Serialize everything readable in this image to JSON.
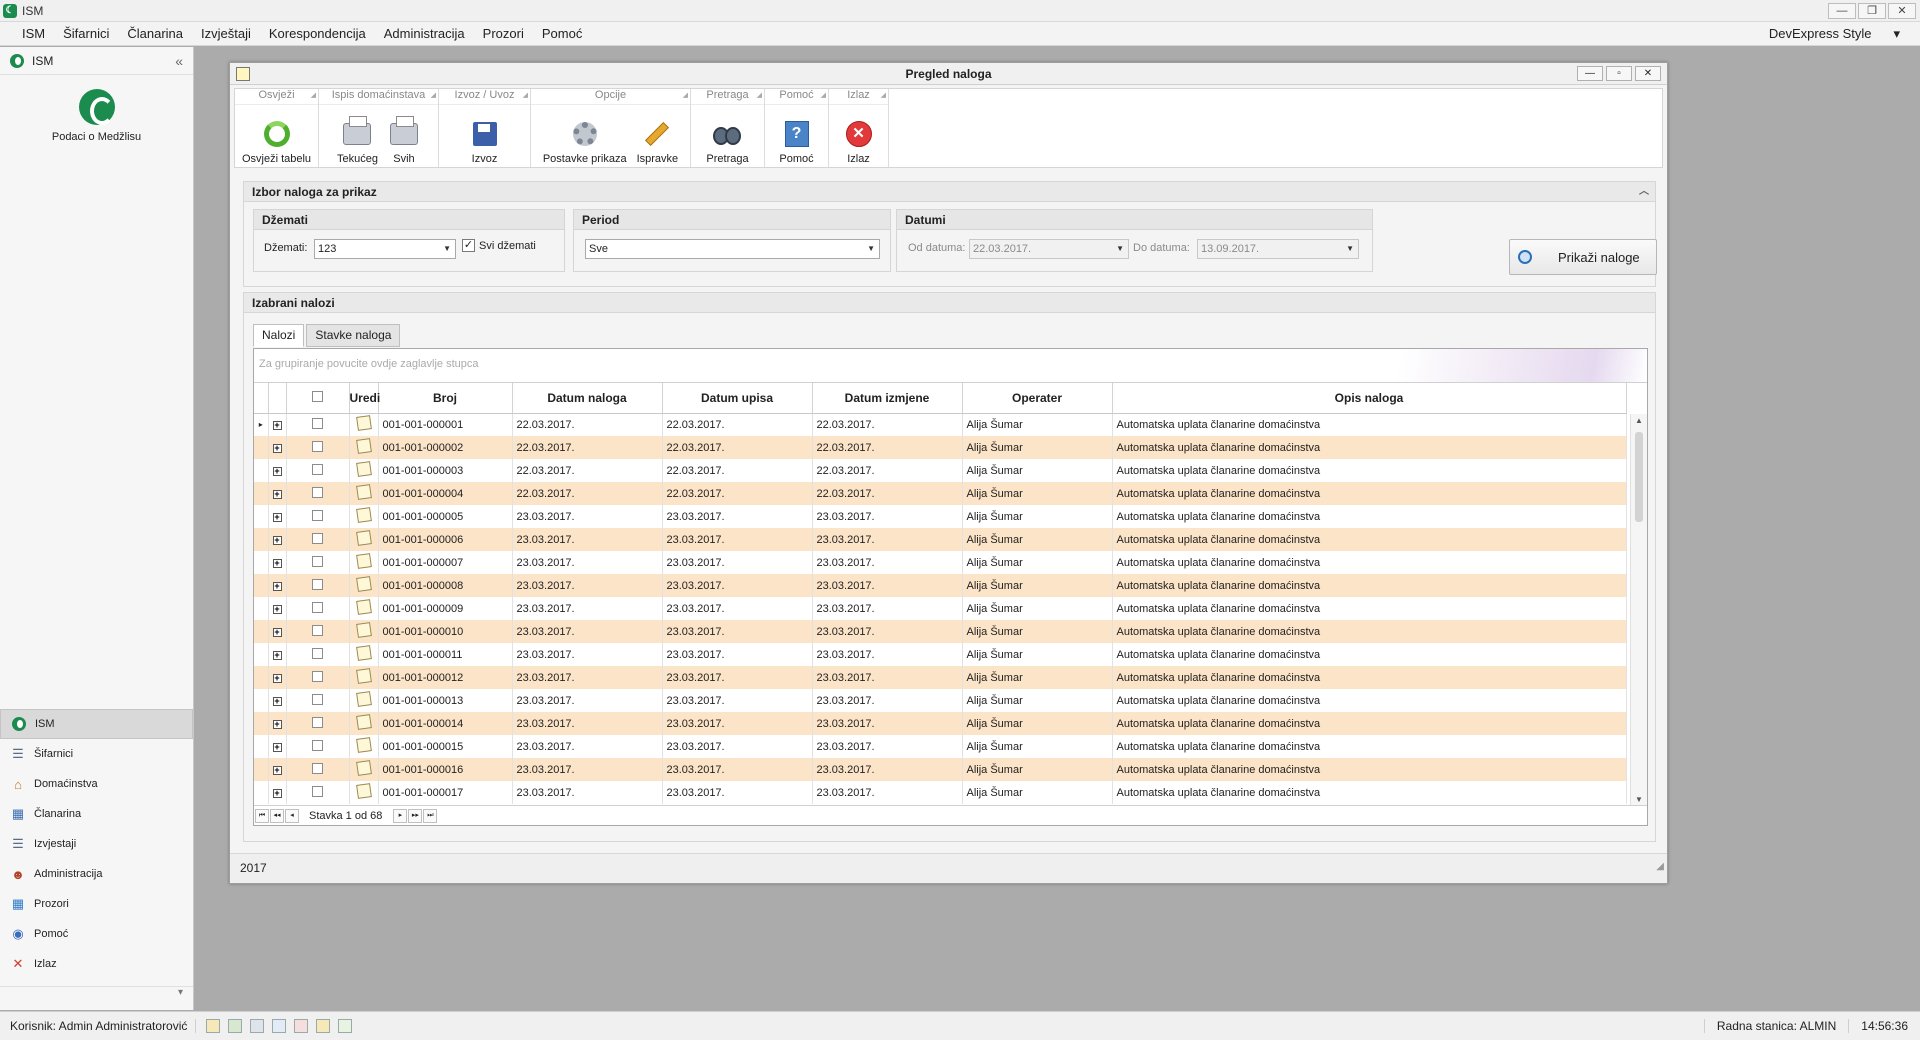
{
  "app": {
    "title": "ISM"
  },
  "menu": {
    "items": [
      "ISM",
      "Šifarnici",
      "Članarina",
      "Izvještaji",
      "Korespondencija",
      "Administracija",
      "Prozori",
      "Pomoć"
    ],
    "style_label": "DevExpress Style",
    "style_arrow": "▾"
  },
  "leftnav": {
    "header": "ISM",
    "collapse": "«",
    "logo_label": "Podaci o Medžlisu",
    "items": [
      {
        "label": "ISM",
        "icon": "green-crescent-icon",
        "glyph": ""
      },
      {
        "label": "Šifarnici",
        "icon": "list-icon",
        "glyph": "☰"
      },
      {
        "label": "Domaćinstva",
        "icon": "house-icon",
        "glyph": "⌂"
      },
      {
        "label": "Članarina",
        "icon": "calendar-icon",
        "glyph": "▦"
      },
      {
        "label": "Izvjestaji",
        "icon": "report-list-icon",
        "glyph": "☰"
      },
      {
        "label": "Administracija",
        "icon": "users-icon",
        "glyph": "☻"
      },
      {
        "label": "Prozori",
        "icon": "windows-icon",
        "glyph": "▦"
      },
      {
        "label": "Pomoć",
        "icon": "help-icon",
        "glyph": "◉"
      },
      {
        "label": "Izlaz",
        "icon": "exit-x-icon",
        "glyph": "✕"
      }
    ],
    "bottom_arrow": "▾"
  },
  "window": {
    "title": "Pregled naloga",
    "minimize": "—",
    "restore": "▫",
    "close": "✕"
  },
  "ribbon": {
    "groups": [
      {
        "title": "Osvježi",
        "buttons": [
          {
            "label": "Osvježi tabelu",
            "icon": "refresh-icon"
          }
        ]
      },
      {
        "title": "Ispis domaćinstava",
        "buttons": [
          {
            "label": "Tekućeg",
            "icon": "printer-icon"
          },
          {
            "label": "Svih",
            "icon": "printer-icon"
          }
        ]
      },
      {
        "title": "Izvoz / Uvoz",
        "buttons": [
          {
            "label": "Izvoz",
            "icon": "export-save-icon"
          }
        ]
      },
      {
        "title": "Opcije",
        "buttons": [
          {
            "label": "Postavke prikaza",
            "icon": "gear-icon"
          },
          {
            "label": "Ispravke",
            "icon": "pencil-icon"
          }
        ]
      },
      {
        "title": "Pretraga",
        "buttons": [
          {
            "label": "Pretraga",
            "icon": "binoculars-icon"
          }
        ]
      },
      {
        "title": "Pomoć",
        "buttons": [
          {
            "label": "Pomoć",
            "icon": "help-icon",
            "glyph": "?"
          }
        ]
      },
      {
        "title": "Izlaz",
        "buttons": [
          {
            "label": "Izlaz",
            "icon": "close-icon",
            "glyph": "✕"
          }
        ]
      }
    ]
  },
  "filter": {
    "title": "Izbor naloga za prikaz",
    "collapse": "︿",
    "dzemati": {
      "title": "Džemati",
      "label": "Džemati:",
      "value": "123",
      "all_label": "Svi džemati",
      "all_checked": "✓"
    },
    "period": {
      "title": "Period",
      "value": "Sve"
    },
    "datumi": {
      "title": "Datumi",
      "from_label": "Od datuma:",
      "from_value": "22.03.2017.",
      "to_label": "Do datuma:",
      "to_value": "13.09.2017."
    },
    "show_button": "Prikaži naloge",
    "dropdown_arrow": "▼"
  },
  "orders": {
    "title": "Izabrani nalozi",
    "tabs": [
      "Nalozi",
      "Stavke naloga"
    ],
    "group_hint": "Za grupiranje povucite ovdje zaglavlje stupca",
    "columns": [
      "",
      "",
      "",
      "Uredi",
      "Broj",
      "Datum naloga",
      "Datum upisa",
      "Datum izmjene",
      "Operater",
      "Opis naloga"
    ],
    "rows": [
      {
        "broj": "001-001-000001",
        "datum_naloga": "22.03.2017.",
        "datum_upisa": "22.03.2017.",
        "datum_izmjene": "22.03.2017.",
        "operater": "Alija Šumar",
        "opis": "Automatska uplata članarine domaćinstva"
      },
      {
        "broj": "001-001-000002",
        "datum_naloga": "22.03.2017.",
        "datum_upisa": "22.03.2017.",
        "datum_izmjene": "22.03.2017.",
        "operater": "Alija Šumar",
        "opis": "Automatska uplata članarine domaćinstva"
      },
      {
        "broj": "001-001-000003",
        "datum_naloga": "22.03.2017.",
        "datum_upisa": "22.03.2017.",
        "datum_izmjene": "22.03.2017.",
        "operater": "Alija Šumar",
        "opis": "Automatska uplata članarine domaćinstva"
      },
      {
        "broj": "001-001-000004",
        "datum_naloga": "22.03.2017.",
        "datum_upisa": "22.03.2017.",
        "datum_izmjene": "22.03.2017.",
        "operater": "Alija Šumar",
        "opis": "Automatska uplata članarine domaćinstva"
      },
      {
        "broj": "001-001-000005",
        "datum_naloga": "23.03.2017.",
        "datum_upisa": "23.03.2017.",
        "datum_izmjene": "23.03.2017.",
        "operater": "Alija Šumar",
        "opis": "Automatska uplata članarine domaćinstva"
      },
      {
        "broj": "001-001-000006",
        "datum_naloga": "23.03.2017.",
        "datum_upisa": "23.03.2017.",
        "datum_izmjene": "23.03.2017.",
        "operater": "Alija Šumar",
        "opis": "Automatska uplata članarine domaćinstva"
      },
      {
        "broj": "001-001-000007",
        "datum_naloga": "23.03.2017.",
        "datum_upisa": "23.03.2017.",
        "datum_izmjene": "23.03.2017.",
        "operater": "Alija Šumar",
        "opis": "Automatska uplata članarine domaćinstva"
      },
      {
        "broj": "001-001-000008",
        "datum_naloga": "23.03.2017.",
        "datum_upisa": "23.03.2017.",
        "datum_izmjene": "23.03.2017.",
        "operater": "Alija Šumar",
        "opis": "Automatska uplata članarine domaćinstva"
      },
      {
        "broj": "001-001-000009",
        "datum_naloga": "23.03.2017.",
        "datum_upisa": "23.03.2017.",
        "datum_izmjene": "23.03.2017.",
        "operater": "Alija Šumar",
        "opis": "Automatska uplata članarine domaćinstva"
      },
      {
        "broj": "001-001-000010",
        "datum_naloga": "23.03.2017.",
        "datum_upisa": "23.03.2017.",
        "datum_izmjene": "23.03.2017.",
        "operater": "Alija Šumar",
        "opis": "Automatska uplata članarine domaćinstva"
      },
      {
        "broj": "001-001-000011",
        "datum_naloga": "23.03.2017.",
        "datum_upisa": "23.03.2017.",
        "datum_izmjene": "23.03.2017.",
        "operater": "Alija Šumar",
        "opis": "Automatska uplata članarine domaćinstva"
      },
      {
        "broj": "001-001-000012",
        "datum_naloga": "23.03.2017.",
        "datum_upisa": "23.03.2017.",
        "datum_izmjene": "23.03.2017.",
        "operater": "Alija Šumar",
        "opis": "Automatska uplata članarine domaćinstva"
      },
      {
        "broj": "001-001-000013",
        "datum_naloga": "23.03.2017.",
        "datum_upisa": "23.03.2017.",
        "datum_izmjene": "23.03.2017.",
        "operater": "Alija Šumar",
        "opis": "Automatska uplata članarine domaćinstva"
      },
      {
        "broj": "001-001-000014",
        "datum_naloga": "23.03.2017.",
        "datum_upisa": "23.03.2017.",
        "datum_izmjene": "23.03.2017.",
        "operater": "Alija Šumar",
        "opis": "Automatska uplata članarine domaćinstva"
      },
      {
        "broj": "001-001-000015",
        "datum_naloga": "23.03.2017.",
        "datum_upisa": "23.03.2017.",
        "datum_izmjene": "23.03.2017.",
        "operater": "Alija Šumar",
        "opis": "Automatska uplata članarine domaćinstva"
      },
      {
        "broj": "001-001-000016",
        "datum_naloga": "23.03.2017.",
        "datum_upisa": "23.03.2017.",
        "datum_izmjene": "23.03.2017.",
        "operater": "Alija Šumar",
        "opis": "Automatska uplata članarine domaćinstva"
      },
      {
        "broj": "001-001-000017",
        "datum_naloga": "23.03.2017.",
        "datum_upisa": "23.03.2017.",
        "datum_izmjene": "23.03.2017.",
        "operater": "Alija Šumar",
        "opis": "Automatska uplata članarine domaćinstva"
      }
    ],
    "row_indicator": "▸",
    "expand_glyph": "+",
    "pager": {
      "first": "⏮",
      "prev_page": "◂◂",
      "prev": "◂",
      "position": "Stavka 1 od 68",
      "next": "▸",
      "next_page": "▸▸",
      "last": "⏭"
    }
  },
  "window_footer": {
    "year": "2017",
    "grip": "◢"
  },
  "status": {
    "user": "Korisnik: Admin Administratorović",
    "station": "Radna stanica: ALMIN",
    "time": "14:56:36"
  },
  "colors": {
    "accent_green": "#1b8b4e",
    "row_alt": "#fce4c8"
  }
}
